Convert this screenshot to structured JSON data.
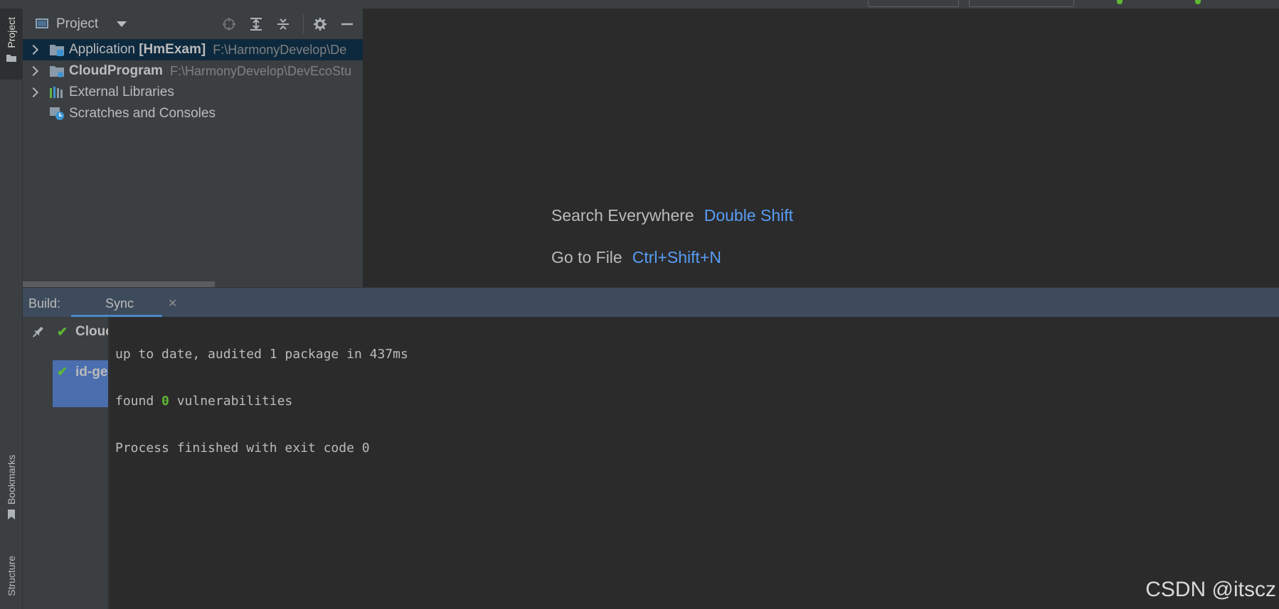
{
  "left_strip": {
    "project_tab": "Project",
    "bookmarks_tab": "Bookmarks",
    "structure_tab": "Structure"
  },
  "project_panel": {
    "title": "Project",
    "tree": [
      {
        "name": "Application",
        "bold_part": "[HmExam]",
        "path": "F:\\HarmonyDevelop\\De",
        "selected": true,
        "expandable": true,
        "icon": "module-folder-icon"
      },
      {
        "name": "",
        "bold_part": "CloudProgram",
        "path": "F:\\HarmonyDevelop\\DevEcoStu",
        "selected": false,
        "expandable": true,
        "icon": "cloud-folder-icon"
      },
      {
        "name": "External Libraries",
        "bold_part": "",
        "path": "",
        "selected": false,
        "expandable": true,
        "icon": "libraries-icon"
      },
      {
        "name": "Scratches and Consoles",
        "bold_part": "",
        "path": "",
        "selected": false,
        "expandable": false,
        "icon": "scratches-icon"
      }
    ]
  },
  "editor": {
    "hints": [
      {
        "label": "Search Everywhere",
        "key": "Double Shift"
      },
      {
        "label": "Go to File",
        "key": "Ctrl+Shift+N"
      }
    ]
  },
  "build": {
    "label": "Build:",
    "tab_label": "Sync",
    "tree": [
      {
        "label": "Clouc",
        "status": "success"
      },
      {
        "label": "id-ge",
        "status": "success",
        "selected": true
      }
    ],
    "console": {
      "line1": "up to date, audited 1 package in 437ms",
      "line2_prefix": "found ",
      "line2_num": "0",
      "line2_suffix": " vulnerabilities",
      "line3": "Process finished with exit code 0"
    }
  },
  "watermark": "CSDN @itscz",
  "colors": {
    "accent_link": "#589df6",
    "success": "#5fb832",
    "selection": "#4b6eaf",
    "background": "#2b2b2b"
  }
}
